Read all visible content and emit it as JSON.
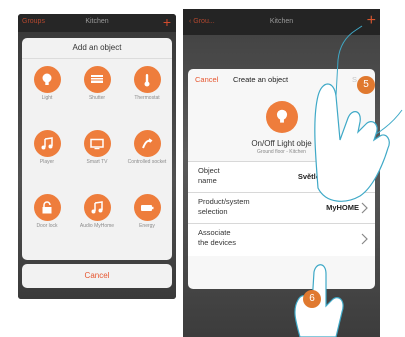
{
  "left_screen": {
    "nav": {
      "back_label": "Groups",
      "title": "Kitchen",
      "plus": "+"
    },
    "panel_title": "Add an object",
    "objects": [
      {
        "label": "Light",
        "icon": "lightbulb-icon"
      },
      {
        "label": "Shutter",
        "icon": "shutter-icon"
      },
      {
        "label": "Thermostat",
        "icon": "thermometer-icon"
      },
      {
        "label": "Player",
        "icon": "music-note-icon"
      },
      {
        "label": "Smart TV",
        "icon": "tv-icon"
      },
      {
        "label": "Controlled socket",
        "icon": "plug-icon"
      },
      {
        "label": "Door lock",
        "icon": "lock-icon"
      },
      {
        "label": "Audio MyHome",
        "icon": "music-note-icon"
      },
      {
        "label": "Energy",
        "icon": "battery-icon"
      }
    ],
    "cancel_label": "Cancel"
  },
  "right_screen": {
    "nav": {
      "back_label": "Grou...",
      "title": "Kitchen",
      "plus": "+"
    },
    "modal": {
      "cancel_label": "Cancel",
      "title": "Create an object",
      "save_label": "S",
      "object_name": "On/Off Light obje",
      "object_location": "Ground floor - Kitchen",
      "rows": [
        {
          "label_line1": "Object",
          "label_line2": "name",
          "value": "Světlo v kuchyni"
        },
        {
          "label_line1": "Product/system",
          "label_line2": "selection",
          "value": "MyHOME"
        },
        {
          "label_line1": "Associate",
          "label_line2": "the devices",
          "value": ""
        }
      ]
    }
  },
  "annotations": {
    "step_5": "5",
    "step_6": "6"
  },
  "colors": {
    "accent": "#ee7d3c",
    "danger_text": "#e6562f",
    "badge": "#e0792f"
  }
}
